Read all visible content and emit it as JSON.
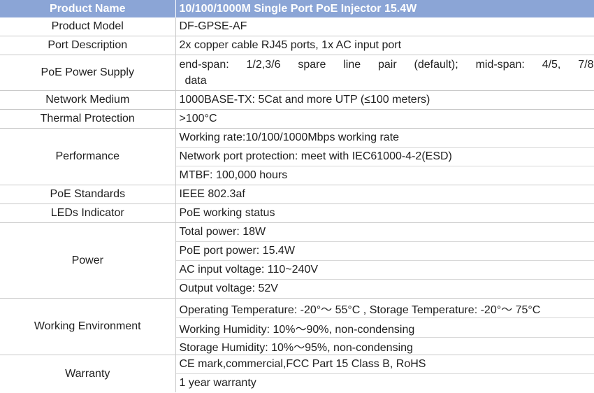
{
  "header": {
    "col1": "Product Name",
    "col2": "10/100/1000M Single Port PoE Injector 15.4W"
  },
  "rows": {
    "model": {
      "label": "Product Model",
      "value": "DF-GPSE-AF"
    },
    "ports": {
      "label": "Port Description",
      "value": "2x copper cable RJ45 ports, 1x AC input port"
    },
    "poe_supply": {
      "label": "PoE Power Supply",
      "line1": "end-span:  1/2,3/6  spare  line  pair  (default);  mid-span:  4/5,  7/8",
      "line2": "data"
    },
    "medium": {
      "label": "Network Medium",
      "value": "1000BASE-TX: 5Cat and more UTP (≤100 meters)"
    },
    "thermal": {
      "label": "Thermal Protection",
      "value": ">100°C"
    },
    "performance": {
      "label": "Performance",
      "values": [
        "Working rate:10/100/1000Mbps working rate",
        "Network port protection: meet with IEC61000-4-2(ESD)",
        "MTBF: 100,000 hours"
      ]
    },
    "standards": {
      "label": "PoE Standards",
      "value": "IEEE 802.3af"
    },
    "leds": {
      "label": "LEDs Indicator",
      "value": "PoE working status"
    },
    "power": {
      "label": "Power",
      "values": [
        "Total power: 18W",
        "PoE port power: 15.4W",
        "AC input voltage: 110~240V",
        "Output voltage: 52V"
      ]
    },
    "environment": {
      "label": "Working Environment",
      "values": [
        "Operating Temperature: -20°～ 55°C , Storage Temperature: -20°～ 75°C",
        "Working Humidity: 10%～90%, non-condensing",
        "Storage Humidity: 10%～95%, non-condensing"
      ]
    },
    "warranty": {
      "label": "Warranty",
      "values": [
        "CE mark,commercial,FCC Part 15 Class B, RoHS",
        "1 year warranty"
      ]
    }
  },
  "colors": {
    "header_bg": "#8ba5d6",
    "header_text": "#ffffff",
    "grid": "#c9c9c9"
  }
}
